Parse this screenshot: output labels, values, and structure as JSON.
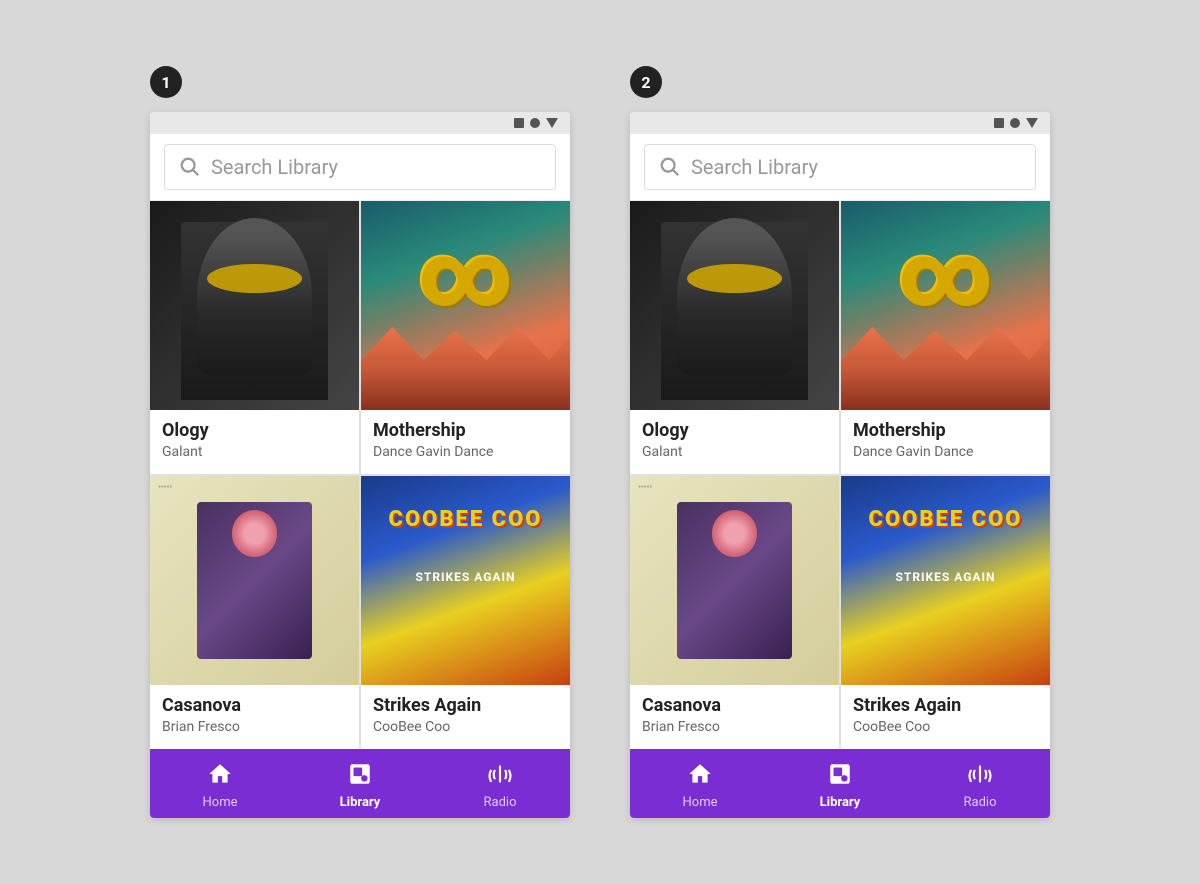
{
  "screens": [
    {
      "number": "1",
      "search": {
        "placeholder": "Search Library"
      },
      "albums": [
        {
          "title": "Ology",
          "artist": "Galant",
          "art": "ology"
        },
        {
          "title": "Mothership",
          "artist": "Dance Gavin Dance",
          "art": "mothership"
        },
        {
          "title": "Casanova",
          "artist": "Brian Fresco",
          "art": "casanova"
        },
        {
          "title": "Strikes Again",
          "artist": "CooBee Coo",
          "art": "strikes"
        }
      ],
      "nav": [
        {
          "label": "Home",
          "icon": "🏠",
          "active": false
        },
        {
          "label": "Library",
          "icon": "📻",
          "active": true
        },
        {
          "label": "Radio",
          "icon": "📡",
          "active": false
        }
      ]
    },
    {
      "number": "2",
      "search": {
        "placeholder": "Search Library"
      },
      "albums": [
        {
          "title": "Ology",
          "artist": "Galant",
          "art": "ology"
        },
        {
          "title": "Mothership",
          "artist": "Dance Gavin Dance",
          "art": "mothership"
        },
        {
          "title": "Casanova",
          "artist": "Brian Fresco",
          "art": "casanova"
        },
        {
          "title": "Strikes Again",
          "artist": "CooBee Coo",
          "art": "strikes"
        }
      ],
      "nav": [
        {
          "label": "Home",
          "icon": "🏠",
          "active": false
        },
        {
          "label": "Library",
          "icon": "📻",
          "active": true
        },
        {
          "label": "Radio",
          "icon": "📡",
          "active": false
        }
      ]
    }
  ]
}
